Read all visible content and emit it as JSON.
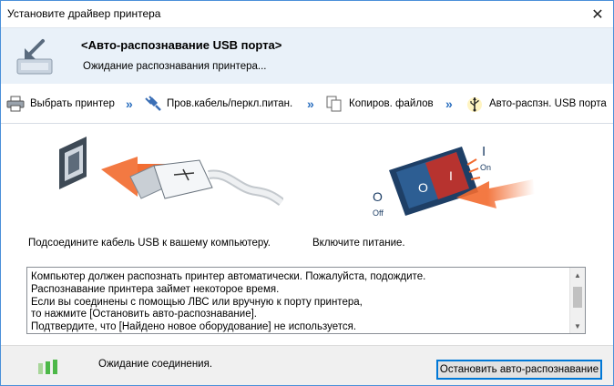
{
  "window": {
    "title": "Установите драйвер принтера",
    "close_glyph": "✕"
  },
  "header": {
    "title": "<Авто-распознавание USB порта>",
    "subtitle": "Ожидание распознавания принтера...",
    "icon": "download-arrow-icon"
  },
  "steps": [
    {
      "label": "Выбрать принтер",
      "icon": "printer-icon"
    },
    {
      "label": "Пров.кабель/перкл.питан.",
      "icon": "plug-icon"
    },
    {
      "label": "Копиров. файлов",
      "icon": "copy-files-icon"
    },
    {
      "label": "Авто-распзн. USB порта",
      "icon": "usb-icon",
      "active": true
    }
  ],
  "step_separator": "»",
  "illustrations": {
    "left_caption": "Подсоедините кабель USB к вашему компьютеру.",
    "right_caption": "Включите питание.",
    "switch_on_label": "On",
    "switch_off_label": "Off",
    "switch_on_symbol": "I",
    "switch_off_symbol": "O"
  },
  "message": {
    "lines": [
      "Компьютер должен распознать принтер автоматически. Пожалуйста, подождите.",
      "Распознавание принтера займет некоторое время.",
      "Если вы соединены с помощью ЛВС или вручную к порту принтера,",
      "то нажмите [Остановить авто-распознавание].",
      "Подтвердите, что [Найдено новое оборудование] не используется."
    ]
  },
  "footer": {
    "status": "Ожидание соединения.",
    "stop_button": "Остановить авто-распознавание",
    "status_icon": "connection-bars-icon"
  },
  "colors": {
    "header_bg": "#e9f1f9",
    "accent": "#2b6fbf",
    "arrow_orange": "#f26a2e",
    "status_green": "#4cb848"
  }
}
